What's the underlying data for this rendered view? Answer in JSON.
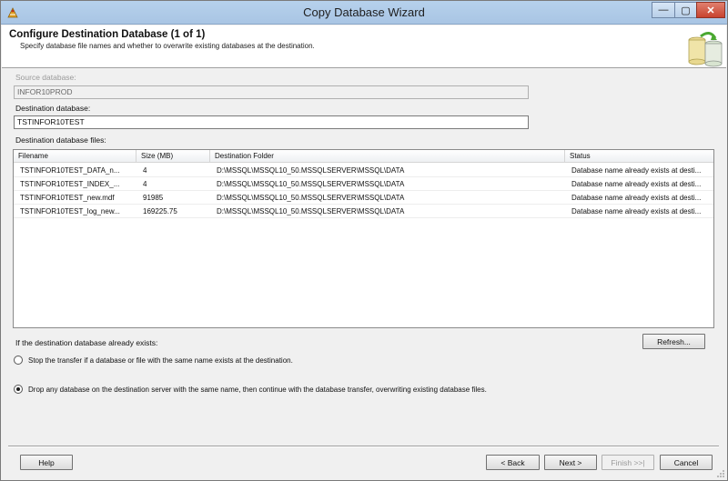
{
  "window": {
    "title": "Copy Database Wizard",
    "controls": {
      "minimize": "—",
      "maximize": "▢",
      "close": "✕"
    }
  },
  "header": {
    "title": "Configure Destination Database (1 of 1)",
    "subtitle": "Specify database file names and whether to overwrite existing databases at the destination."
  },
  "source": {
    "label": "Source database:",
    "value": "INFOR10PROD"
  },
  "destination": {
    "label": "Destination database:",
    "value": "TSTINFOR10TEST"
  },
  "files": {
    "label": "Destination database files:",
    "columns": [
      "Filename",
      "Size (MB)",
      "Destination Folder",
      "Status"
    ],
    "rows": [
      [
        "TSTINFOR10TEST_DATA_n...",
        "4",
        "D:\\MSSQL\\MSSQL10_50.MSSQLSERVER\\MSSQL\\DATA",
        "Database name already exists at desti..."
      ],
      [
        "TSTINFOR10TEST_INDEX_...",
        "4",
        "D:\\MSSQL\\MSSQL10_50.MSSQLSERVER\\MSSQL\\DATA",
        "Database name already exists at desti..."
      ],
      [
        "TSTINFOR10TEST_new.mdf",
        "91985",
        "D:\\MSSQL\\MSSQL10_50.MSSQLSERVER\\MSSQL\\DATA",
        "Database name already exists at desti..."
      ],
      [
        "TSTINFOR10TEST_log_new...",
        "169225.75",
        "D:\\MSSQL\\MSSQL10_50.MSSQLSERVER\\MSSQL\\DATA",
        "Database name already exists at desti..."
      ]
    ]
  },
  "exists_options": {
    "label": "If the destination database already exists:",
    "refresh": "Refresh...",
    "stop": "Stop the transfer if a database or file with the same name exists at the destination.",
    "drop": "Drop any database on the destination server with the same name, then continue with the database transfer, overwriting existing database files.",
    "selected": "drop"
  },
  "footer": {
    "help": "Help",
    "back": "< Back",
    "next": "Next >",
    "finish": "Finish >>|",
    "cancel": "Cancel"
  }
}
